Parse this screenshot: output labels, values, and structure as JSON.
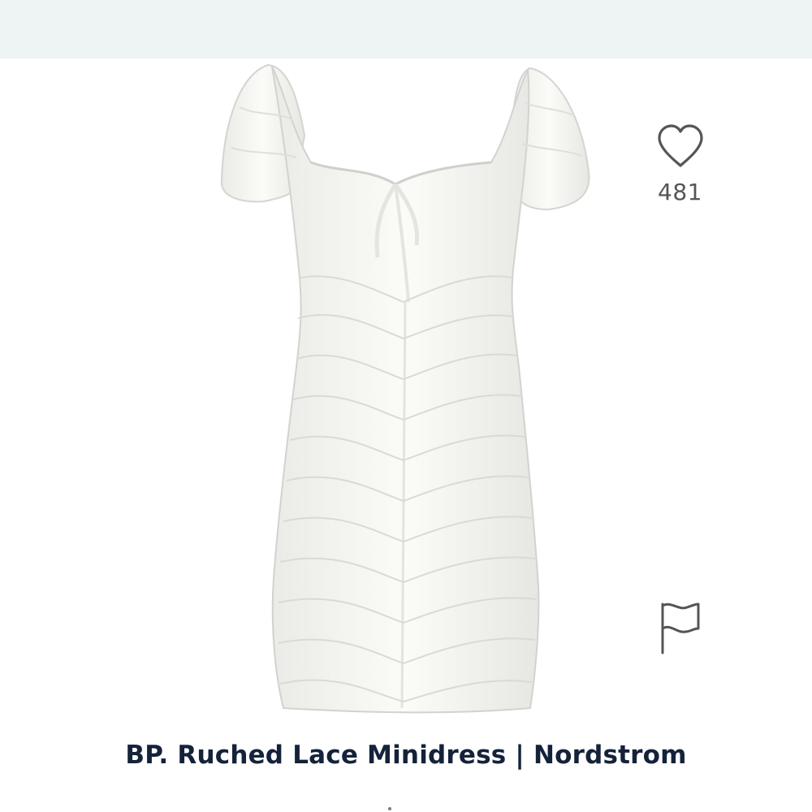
{
  "header": {
    "background": "#eef4f4"
  },
  "product": {
    "title": "BP. Ruched Lace Minidress | Nordstrom",
    "image_icon": "white-ruched-lace-minidress",
    "likes": "481"
  },
  "actions": {
    "like_icon": "heart-icon",
    "report_icon": "flag-icon"
  },
  "colors": {
    "title": "#14223a",
    "count": "#555555",
    "icon_stroke": "#555555"
  }
}
